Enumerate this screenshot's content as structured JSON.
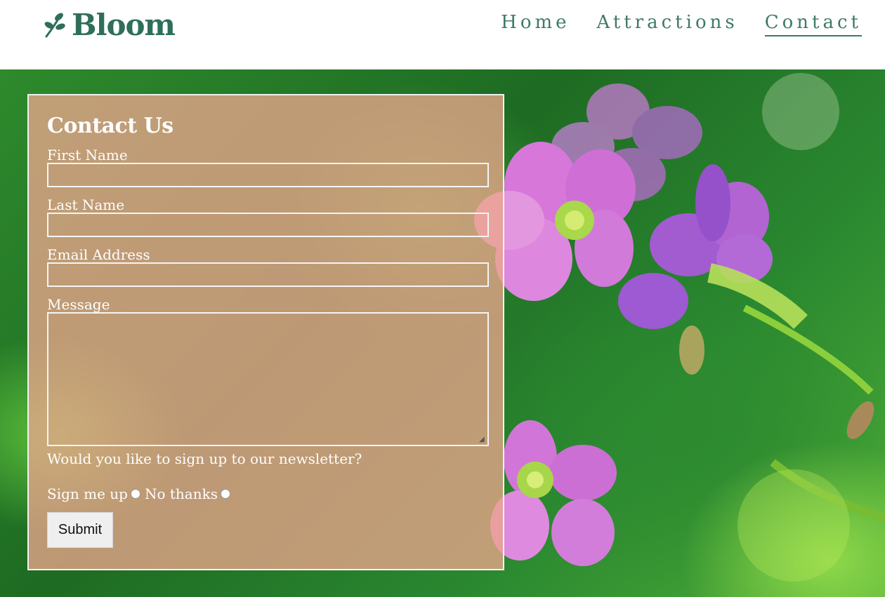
{
  "header": {
    "logo_text": "Bloom",
    "nav": [
      {
        "label": "Home",
        "active": false
      },
      {
        "label": "Attractions",
        "active": false
      },
      {
        "label": "Contact",
        "active": true
      }
    ]
  },
  "form": {
    "title": "Contact Us",
    "first_name_label": "First Name",
    "first_name_value": "",
    "last_name_label": "Last Name",
    "last_name_value": "",
    "email_label": "Email Address",
    "email_value": "",
    "message_label": "Message",
    "message_value": "",
    "newsletter_question": "Would you like to sign up to our newsletter?",
    "radio_options": [
      "Sign me up",
      "No thanks"
    ],
    "submit_label": "Submit"
  },
  "colors": {
    "brand": "#2f6f5a",
    "panel_overlay": "#eba58c",
    "background_green": "#2e8a2c",
    "flower_pink": "#d977d6"
  },
  "icons": {
    "logo_icon": "leaf-sprig-icon"
  }
}
